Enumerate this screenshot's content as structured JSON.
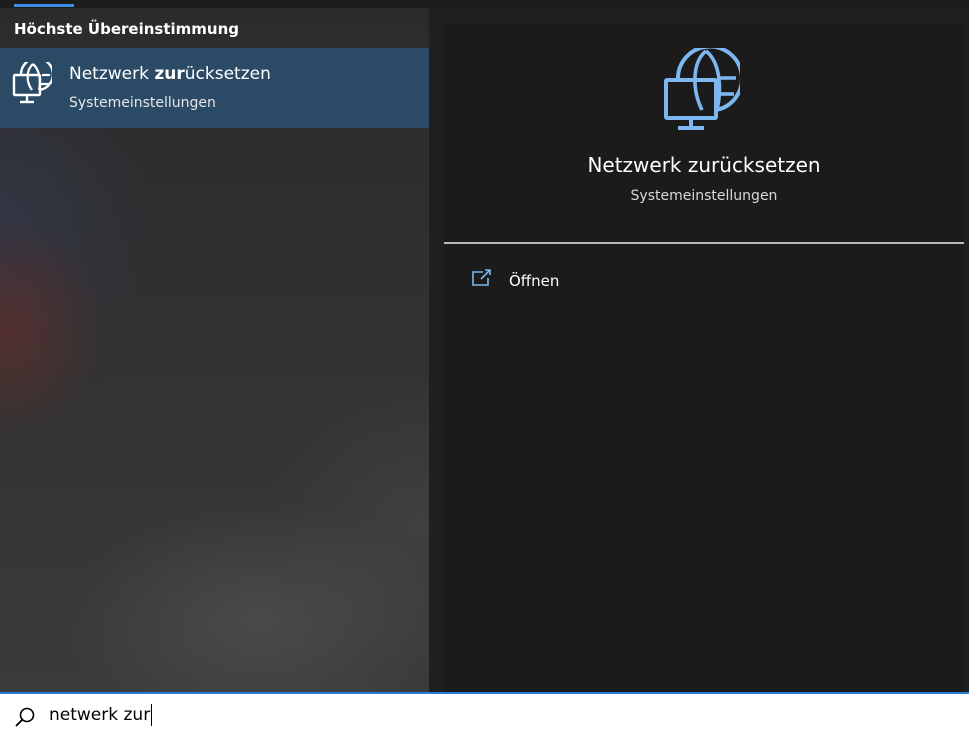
{
  "results": {
    "section_heading": "Höchste Übereinstimmung",
    "best_match": {
      "title_bold": "zur",
      "title_prefix": "Netzwerk ",
      "title_suffix": "ücksetzen",
      "subtitle": "Systemeinstellungen",
      "icon": "globe-monitor-icon"
    }
  },
  "detail": {
    "title": "Netzwerk zurücksetzen",
    "subtitle": "Systemeinstellungen",
    "icon": "globe-monitor-icon",
    "actions": [
      {
        "label": "Öffnen",
        "icon": "open-external-icon"
      }
    ]
  },
  "search": {
    "value": "netwerk zur",
    "icon": "search-icon"
  },
  "colors": {
    "accent": "#3a8ee6",
    "selected_row": "#2b4a66",
    "icon_blue": "#7cb8ef",
    "panel": "#1b1b1b"
  }
}
